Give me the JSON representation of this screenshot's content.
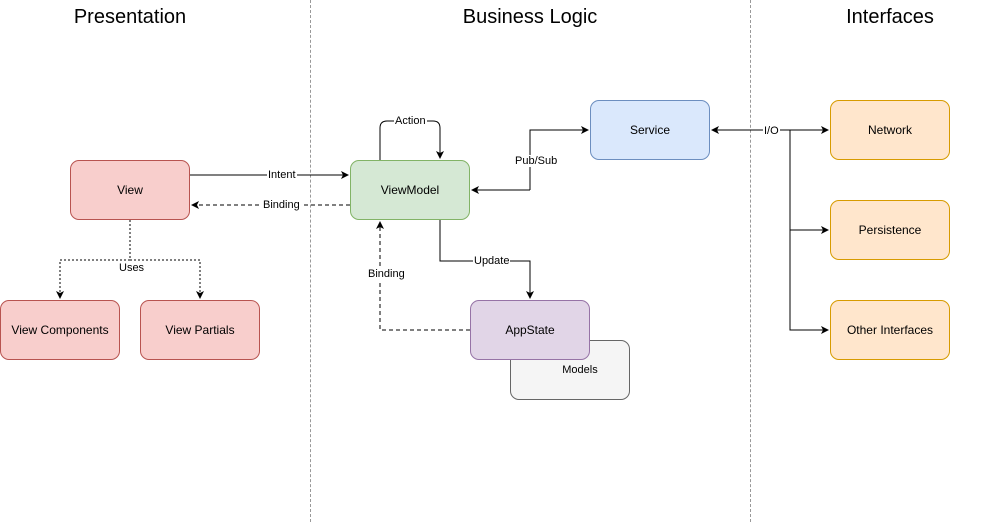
{
  "columns": [
    {
      "title": "Presentation"
    },
    {
      "title": "Business Logic"
    },
    {
      "title": "Interfaces"
    }
  ],
  "nodes": {
    "view": "View",
    "view_components": "View Components",
    "view_partials": "View Partials",
    "viewmodel": "ViewModel",
    "service": "Service",
    "appstate": "AppState",
    "models": "Models",
    "network": "Network",
    "persistence": "Persistence",
    "other_interfaces": "Other Interfaces"
  },
  "edges": {
    "intent": "Intent",
    "binding_view": "Binding",
    "uses": "Uses",
    "action": "Action",
    "pubsub": "Pub/Sub",
    "update": "Update",
    "binding_appstate": "Binding",
    "io": "I/O"
  }
}
